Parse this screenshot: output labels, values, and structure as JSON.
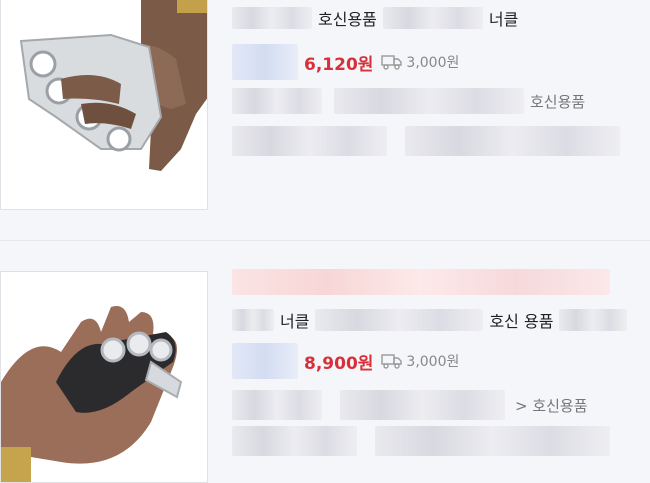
{
  "items": [
    {
      "title_parts": [
        "호신용품",
        "너클"
      ],
      "price": "6,120원",
      "shipping": "3,000원",
      "category": "호신용품"
    },
    {
      "title_line2_parts": [
        "너클",
        "호신 용품"
      ],
      "price": "8,900원",
      "shipping": "3,000원",
      "category": "> 호신용품"
    }
  ],
  "icons": {
    "shipping": "truck-icon"
  },
  "colors": {
    "price": "#d7303a",
    "background": "#f5f6fa"
  }
}
